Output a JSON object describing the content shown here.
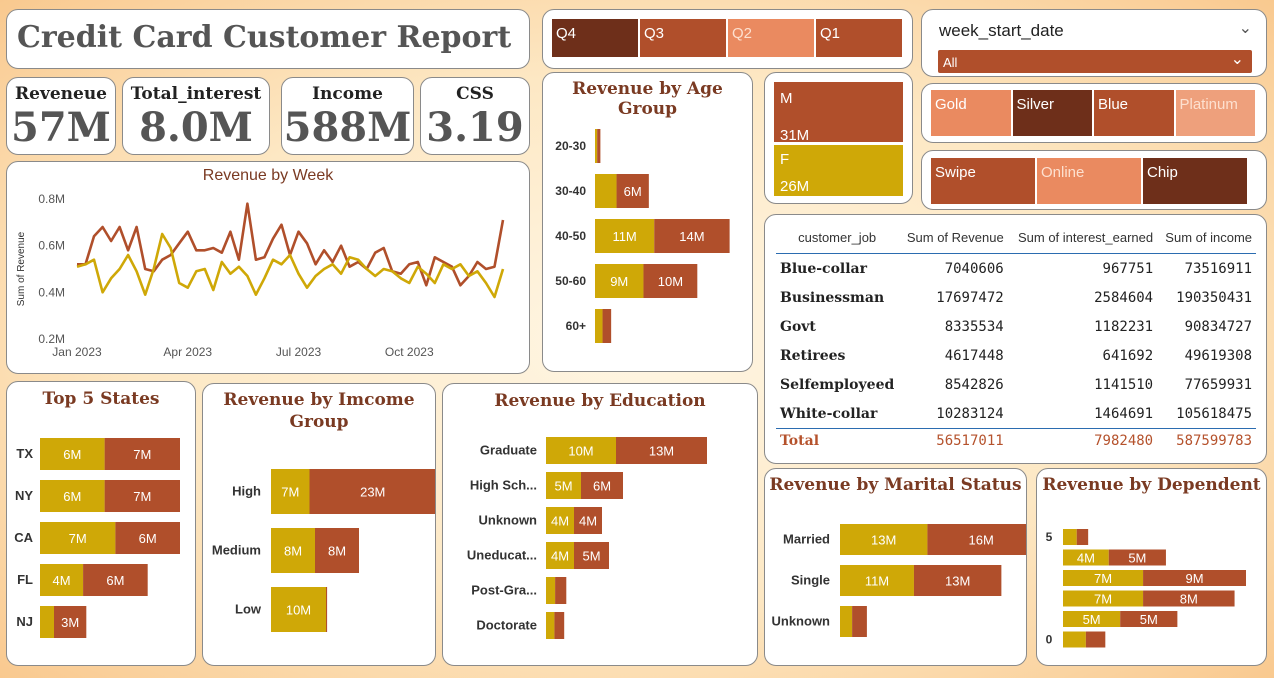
{
  "title": "Credit Card Customer Report",
  "kpis": [
    {
      "label": "Reveneue",
      "value": "57M"
    },
    {
      "label": "Total_interest",
      "value": "8.0M"
    },
    {
      "label": "Income",
      "value": "588M"
    },
    {
      "label": "CSS",
      "value": "3.19"
    }
  ],
  "slicers": {
    "quarters": [
      "Q4",
      "Q3",
      "Q2",
      "Q1"
    ],
    "week_filter": {
      "label": "week_start_date",
      "value": "All"
    },
    "card_categories": [
      "Gold",
      "Silver",
      "Blue",
      "Platinum"
    ],
    "use_chip": [
      "Swipe",
      "Online",
      "Chip"
    ]
  },
  "gender": [
    {
      "label": "M",
      "value": "31M"
    },
    {
      "label": "F",
      "value": "26M"
    }
  ],
  "colors": {
    "gold": "#cfa807",
    "rust": "#b04f2b",
    "dark": "#6e2f1a",
    "salmon": "#ea8a60",
    "peach": "#eea07c",
    "title": "#7a3a22"
  },
  "table": {
    "headers": [
      "customer_job",
      "Sum of Revenue",
      "Sum of interest_earned",
      "Sum of income"
    ],
    "rows": [
      [
        "Blue-collar",
        "7040606",
        "967751",
        "73516911"
      ],
      [
        "Businessman",
        "17697472",
        "2584604",
        "190350431"
      ],
      [
        "Govt",
        "8335534",
        "1182231",
        "90834727"
      ],
      [
        "Retirees",
        "4617448",
        "641692",
        "49619308"
      ],
      [
        "Selfemployeed",
        "8542826",
        "1141510",
        "77659931"
      ],
      [
        "White-collar",
        "10283124",
        "1464691",
        "105618475"
      ]
    ],
    "total": [
      "Total",
      "56517011",
      "7982480",
      "587599783"
    ]
  },
  "chart_data": [
    {
      "id": "week",
      "type": "line",
      "title": "Revenue by Week",
      "ylabel": "Sum of Revenue",
      "ylim": [
        0.2,
        0.8
      ],
      "yticks": [
        {
          "v": 0.2,
          "label": "0.2M"
        },
        {
          "v": 0.4,
          "label": "0.4M"
        },
        {
          "v": 0.6,
          "label": "0.6M"
        },
        {
          "v": 0.8,
          "label": "0.8M"
        }
      ],
      "xticks": [
        {
          "i": 0,
          "label": "Jan 2023"
        },
        {
          "i": 13,
          "label": "Apr 2023"
        },
        {
          "i": 26,
          "label": "Jul 2023"
        },
        {
          "i": 39,
          "label": "Oct 2023"
        }
      ],
      "series": [
        {
          "color": "#b04f2b",
          "values": [
            0.52,
            0.52,
            0.64,
            0.68,
            0.62,
            0.68,
            0.58,
            0.68,
            0.5,
            0.49,
            0.54,
            0.56,
            0.61,
            0.66,
            0.58,
            0.58,
            0.59,
            0.57,
            0.66,
            0.54,
            0.78,
            0.54,
            0.55,
            0.63,
            0.69,
            0.56,
            0.66,
            0.61,
            0.52,
            0.58,
            0.53,
            0.6,
            0.51,
            0.53,
            0.5,
            0.57,
            0.59,
            0.49,
            0.48,
            0.52,
            0.53,
            0.43,
            0.55,
            0.53,
            0.51,
            0.43,
            0.47,
            0.53,
            0.5,
            0.51,
            0.71
          ]
        },
        {
          "color": "#cfa807",
          "values": [
            0.51,
            0.52,
            0.54,
            0.4,
            0.46,
            0.5,
            0.56,
            0.49,
            0.39,
            0.5,
            0.65,
            0.59,
            0.44,
            0.42,
            0.49,
            0.5,
            0.41,
            0.53,
            0.48,
            0.51,
            0.47,
            0.39,
            0.46,
            0.54,
            0.52,
            0.56,
            0.48,
            0.42,
            0.47,
            0.5,
            0.52,
            0.48,
            0.55,
            0.54,
            0.5,
            0.47,
            0.5,
            0.49,
            0.46,
            0.44,
            0.51,
            0.48,
            0.44,
            0.52,
            0.5,
            0.52,
            0.47,
            0.49,
            0.44,
            0.38,
            0.5
          ]
        }
      ]
    },
    {
      "id": "age",
      "type": "bar",
      "title": "Revenue by Age Group",
      "max": 26,
      "categories": [
        "20-30",
        "30-40",
        "40-50",
        "50-60",
        "60+"
      ],
      "series": [
        {
          "color": "#cfa807",
          "values": [
            0.4,
            4,
            11,
            9,
            1.4
          ],
          "labels": [
            "",
            "",
            "11M",
            "9M",
            ""
          ]
        },
        {
          "color": "#b04f2b",
          "values": [
            0.6,
            6,
            14,
            10,
            1.6
          ],
          "labels": [
            "",
            "6M",
            "14M",
            "10M",
            ""
          ]
        }
      ]
    },
    {
      "id": "states",
      "type": "bar",
      "title": "Top 5 States",
      "max": 13,
      "categories": [
        "TX",
        "NY",
        "CA",
        "FL",
        "NJ"
      ],
      "series": [
        {
          "color": "#cfa807",
          "values": [
            6,
            6,
            7,
            4,
            1.3
          ],
          "labels": [
            "6M",
            "6M",
            "7M",
            "4M",
            ""
          ]
        },
        {
          "color": "#b04f2b",
          "values": [
            7,
            7,
            6,
            6,
            3
          ],
          "labels": [
            "7M",
            "7M",
            "6M",
            "6M",
            "3M"
          ]
        }
      ]
    },
    {
      "id": "income",
      "type": "bar",
      "title": "Revenue by Imcome Group",
      "max": 30,
      "categories": [
        "High",
        "Medium",
        "Low"
      ],
      "series": [
        {
          "color": "#cfa807",
          "values": [
            7,
            8,
            10
          ],
          "labels": [
            "7M",
            "8M",
            "10M"
          ]
        },
        {
          "color": "#b04f2b",
          "values": [
            23,
            8,
            0.2
          ],
          "labels": [
            "23M",
            "8M",
            ""
          ]
        }
      ]
    },
    {
      "id": "education",
      "type": "bar",
      "title": "Revenue by Education",
      "max": 23,
      "categories": [
        "Graduate",
        "High Sch...",
        "Unknown",
        "Uneducat...",
        "Post-Gra...",
        "Doctorate"
      ],
      "series": [
        {
          "color": "#cfa807",
          "values": [
            10,
            5,
            4,
            4,
            1.3,
            1.2
          ],
          "labels": [
            "10M",
            "5M",
            "4M",
            "4M",
            "",
            ""
          ]
        },
        {
          "color": "#b04f2b",
          "values": [
            13,
            6,
            4,
            5,
            1.6,
            1.4
          ],
          "labels": [
            "13M",
            "6M",
            "4M",
            "5M",
            "",
            ""
          ]
        }
      ]
    },
    {
      "id": "marital",
      "type": "bar",
      "title": "Revenue by Marital Status",
      "max": 29,
      "categories": [
        "Married",
        "Single",
        "Unknown"
      ],
      "series": [
        {
          "color": "#cfa807",
          "values": [
            13,
            11,
            1.8
          ],
          "labels": [
            "13M",
            "11M",
            ""
          ]
        },
        {
          "color": "#b04f2b",
          "values": [
            16,
            13,
            2.2
          ],
          "labels": [
            "16M",
            "13M",
            ""
          ]
        }
      ]
    },
    {
      "id": "dependent",
      "type": "bar",
      "title": "Revenue by Dependent",
      "max": 16,
      "categories": [
        "5",
        "",
        "",
        "",
        "",
        "0"
      ],
      "series": [
        {
          "color": "#cfa807",
          "values": [
            1.2,
            4,
            7,
            7,
            5,
            2
          ],
          "labels": [
            "",
            "4M",
            "7M",
            "7M",
            "5M",
            ""
          ]
        },
        {
          "color": "#b04f2b",
          "values": [
            1.0,
            5,
            9,
            8,
            5,
            1.7
          ],
          "labels": [
            "",
            "5M",
            "9M",
            "8M",
            "5M",
            ""
          ]
        }
      ]
    }
  ]
}
